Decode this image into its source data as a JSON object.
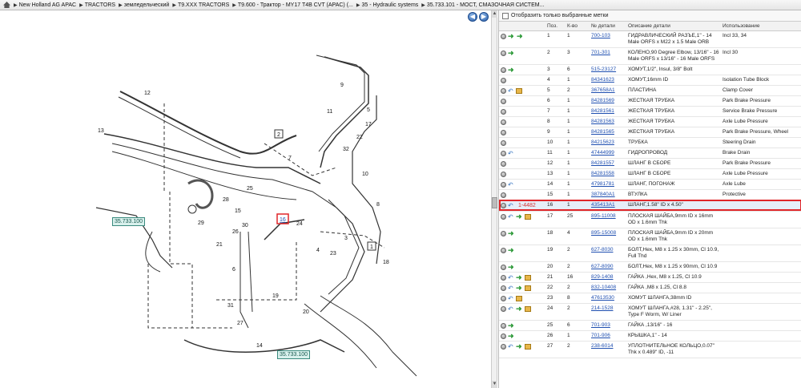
{
  "breadcrumb": [
    "New Holland AG APAC",
    "TRACTORS",
    "земледельческий",
    "T9.XXX TRACTORS",
    "T9.600 - Трактор - MY17 T4B CVT (APAC) (...",
    "35 - Hydraulic systems",
    "35.733.101 - МОСТ, СМАЗОЧНАЯ СИСТЕМ..."
  ],
  "nav": {
    "back": "◀",
    "forward": "▶"
  },
  "diagram": {
    "callouts": [
      "1",
      "2",
      "3",
      "4",
      "5",
      "6",
      "7",
      "8",
      "9",
      "10",
      "11",
      "12",
      "13",
      "14",
      "15",
      "16",
      "17",
      "18",
      "19",
      "20",
      "21",
      "22",
      "23",
      "24",
      "25",
      "26",
      "27",
      "28",
      "29",
      "30",
      "31",
      "32"
    ],
    "crossrefs": [
      "35.733.100",
      "35.733.100"
    ],
    "highlight_label": "16"
  },
  "filter": {
    "label": "Отобразить только выбранные метки"
  },
  "columns": [
    "",
    "Поз.",
    "К-во",
    "№ детали",
    "Описание детали",
    "Использование"
  ],
  "selected_note": "1-4482",
  "rows": [
    {
      "pos": "1",
      "qty": "1",
      "part": "700-103",
      "desc": "ГИДРАВЛИЧЕСКИЙ РАЗЪЕ,1\" - 14 Male ORFS x M22 x 1.5 Male ORB",
      "use": "Incl 33, 34",
      "icons": "ogr"
    },
    {
      "pos": "2",
      "qty": "3",
      "part": "701-301",
      "desc": "КОЛЕНО,90 Degree Elbow, 13/16\" - 16 Male ORFS x 13/16\" - 16 Male ORFS",
      "use": "Incl 30",
      "icons": "og"
    },
    {
      "pos": "3",
      "qty": "6",
      "part": "515-23127",
      "desc": "ХОМУТ,1/2\", Insul, 3/8\" Bolt",
      "use": "",
      "icons": "og"
    },
    {
      "pos": "4",
      "qty": "1",
      "part": "84341623",
      "desc": "ХОМУТ,16mm ID",
      "use": "Isolation Tube Block",
      "icons": "o"
    },
    {
      "pos": "5",
      "qty": "2",
      "part": "367658A1",
      "desc": "ПЛАСТИНА",
      "use": "Clamp Cover",
      "icons": "obx"
    },
    {
      "pos": "6",
      "qty": "1",
      "part": "84281569",
      "desc": "ЖЕСТКАЯ ТРУБКА",
      "use": "Park Brake Pressure",
      "icons": "o"
    },
    {
      "pos": "7",
      "qty": "1",
      "part": "84281561",
      "desc": "ЖЕСТКАЯ ТРУБКА",
      "use": "Service Brake Pressure",
      "icons": "o"
    },
    {
      "pos": "8",
      "qty": "1",
      "part": "84281563",
      "desc": "ЖЕСТКАЯ ТРУБКА",
      "use": "Axle Lube Pressure",
      "icons": "o"
    },
    {
      "pos": "9",
      "qty": "1",
      "part": "84281565",
      "desc": "ЖЕСТКАЯ ТРУБКА",
      "use": "Park Brake Pressure, Wheel",
      "icons": "o"
    },
    {
      "pos": "10",
      "qty": "1",
      "part": "84215623",
      "desc": "ТРУБКА",
      "use": "Steering Drain",
      "icons": "o"
    },
    {
      "pos": "11",
      "qty": "1",
      "part": "47444999",
      "desc": "ГИДРОПРОВОД",
      "use": "Brake Drain",
      "icons": "ob"
    },
    {
      "pos": "12",
      "qty": "1",
      "part": "84281557",
      "desc": "ШЛАНГ В СБОРЕ",
      "use": "Park Brake Pressure",
      "icons": "o"
    },
    {
      "pos": "13",
      "qty": "1",
      "part": "84281558",
      "desc": "ШЛАНГ В СБОРЕ",
      "use": "Axle Lube Pressure",
      "icons": "o"
    },
    {
      "pos": "14",
      "qty": "1",
      "part": "47981781",
      "desc": "ШЛАНГ, ПОГОНАЖ",
      "use": "Axle Lube",
      "icons": "ob"
    },
    {
      "pos": "15",
      "qty": "1",
      "part": "387840A1",
      "desc": "ВТУЛКА",
      "use": "Protective",
      "icons": "o"
    },
    {
      "pos": "16",
      "qty": "1",
      "part": "435413A1",
      "desc": "ШЛАНГ,1.58\" ID x 4.50\"",
      "use": "",
      "icons": "ob",
      "selected": true
    },
    {
      "pos": "17",
      "qty": "25",
      "part": "895-11008",
      "desc": "ПЛОСКАЯ ШАЙБА,9mm ID x 16mm OD x 1.6mm Thk",
      "use": "",
      "icons": "obgx"
    },
    {
      "pos": "18",
      "qty": "4",
      "part": "895-15008",
      "desc": "ПЛОСКАЯ ШАЙБА,9mm ID x 20mm OD x 1.6mm Thk",
      "use": "",
      "icons": "og"
    },
    {
      "pos": "19",
      "qty": "2",
      "part": "627-8030",
      "desc": "БОЛТ,Hex, M8 x 1.25 x 30mm, Cl 10.9, Full Thd",
      "use": "",
      "icons": "og"
    },
    {
      "pos": "20",
      "qty": "2",
      "part": "627-8090",
      "desc": "БОЛТ,Hex, M8 x 1.25 x 90mm, Cl 10.9",
      "use": "",
      "icons": "og"
    },
    {
      "pos": "21",
      "qty": "16",
      "part": "829-1408",
      "desc": "ГАЙКА ,Hex, M8 x 1.25, Cl 10.9",
      "use": "",
      "icons": "obgx"
    },
    {
      "pos": "22",
      "qty": "2",
      "part": "832-10408",
      "desc": "ГАЙКА ,M8 x 1.25, Cl 8.8",
      "use": "",
      "icons": "obgx"
    },
    {
      "pos": "23",
      "qty": "8",
      "part": "47613530",
      "desc": "ХОМУТ ШЛАНГА,38mm ID",
      "use": "",
      "icons": "obx"
    },
    {
      "pos": "24",
      "qty": "2",
      "part": "214-1528",
      "desc": "ХОМУТ ШЛАНГА,#28, 1.31\" - 2.25\", Type F Worm, W/ Liner",
      "use": "",
      "icons": "obgx"
    },
    {
      "pos": "25",
      "qty": "6",
      "part": "701-903",
      "desc": "ГАЙКА ,13/16\" - 16",
      "use": "",
      "icons": "og"
    },
    {
      "pos": "26",
      "qty": "1",
      "part": "701-906",
      "desc": "КРЫШКА,1\" - 14",
      "use": "",
      "icons": "og"
    },
    {
      "pos": "27",
      "qty": "2",
      "part": "238-6014",
      "desc": "УПЛОТНИТЕЛЬНОЕ КОЛЬЦО,0.07\" Thk x 0.489\" ID, -11",
      "use": "",
      "icons": "obgx"
    }
  ]
}
